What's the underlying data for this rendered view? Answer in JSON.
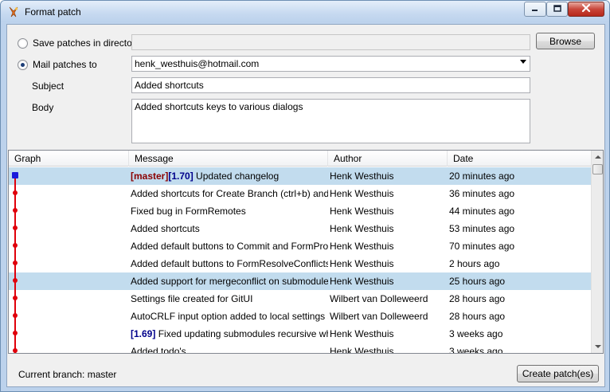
{
  "window": {
    "title": "Format patch",
    "close_glyph": "✕",
    "min_glyph": "▁",
    "max_glyph": "☐"
  },
  "options": {
    "save_label": "Save patches in directory",
    "save_value": "",
    "browse_label": "Browse",
    "mail_label": "Mail patches to",
    "mail_value": "henk_westhuis@hotmail.com",
    "subject_label": "Subject",
    "subject_value": "Added shortcuts",
    "body_label": "Body",
    "body_value": "Added shortcuts keys to various dialogs"
  },
  "grid": {
    "columns": [
      "Graph",
      "Message",
      "Author",
      "Date"
    ],
    "rows": [
      {
        "branch_tag": "[master]",
        "version_tag": "[1.70]",
        "message": " Updated changelog",
        "author": "Henk Westhuis",
        "date": "20 minutes ago"
      },
      {
        "branch_tag": "",
        "version_tag": "",
        "message": "Added shortcuts for Create Branch (ctrl+b) and Create Tag",
        "author": "Henk Westhuis",
        "date": "36 minutes ago"
      },
      {
        "branch_tag": "",
        "version_tag": "",
        "message": "Fixed bug in FormRemotes",
        "author": "Henk Westhuis",
        "date": "44 minutes ago"
      },
      {
        "branch_tag": "",
        "version_tag": "",
        "message": "Added shortcuts",
        "author": "Henk Westhuis",
        "date": "53 minutes ago"
      },
      {
        "branch_tag": "",
        "version_tag": "",
        "message": "Added default buttons to Commit and FormProcess",
        "author": "Henk Westhuis",
        "date": "70 minutes ago"
      },
      {
        "branch_tag": "",
        "version_tag": "",
        "message": "Added default buttons to FormResolveConflicts and",
        "author": "Henk Westhuis",
        "date": "2 hours ago"
      },
      {
        "branch_tag": "",
        "version_tag": "",
        "message": "Added support for mergeconflict on submodules",
        "author": "Henk Westhuis",
        "date": "25 hours ago"
      },
      {
        "branch_tag": "",
        "version_tag": "",
        "message": "Settings file created for GitUI",
        "author": "Wilbert van Dolleweerd",
        "date": "28 hours ago"
      },
      {
        "branch_tag": "",
        "version_tag": "",
        "message": "AutoCRLF input option added to local settings screen",
        "author": "Wilbert van Dolleweerd",
        "date": "28 hours ago"
      },
      {
        "branch_tag": "",
        "version_tag": "[1.69]",
        "message": " Fixed updating submodules recursive when",
        "author": "Henk Westhuis",
        "date": "3 weeks ago"
      },
      {
        "branch_tag": "",
        "version_tag": "",
        "message": "Added todo's",
        "author": "Henk Westhuis",
        "date": "3 weeks ago"
      }
    ]
  },
  "footer": {
    "current_branch": "Current branch: master",
    "create_label": "Create patch(es)"
  },
  "colors": {
    "selection": "#c2dcee",
    "graph_line": "#e0000b",
    "head_node": "#1a1adb",
    "branch_tag": "#8b0000",
    "version_tag": "#00008b"
  },
  "icons": {
    "app": "git-extensions-icon",
    "scroll_up": "arrow-up-icon",
    "scroll_down": "arrow-down-icon"
  }
}
